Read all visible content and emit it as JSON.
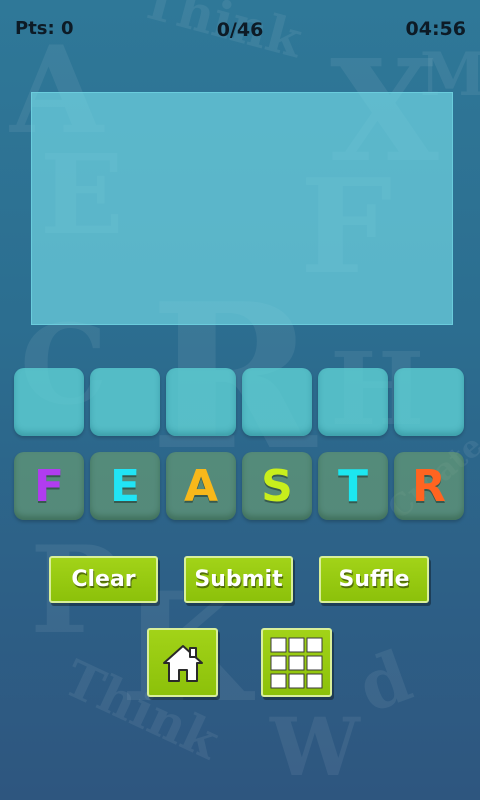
{
  "status": {
    "points_label": "Pts: 0",
    "progress": "0/46",
    "timer": "04:56"
  },
  "answer_display": {
    "current_word": ""
  },
  "answer_slots": 6,
  "letters": [
    {
      "char": "F",
      "color": "#b13cf0"
    },
    {
      "char": "E",
      "color": "#21e4f5"
    },
    {
      "char": "A",
      "color": "#f7b81a"
    },
    {
      "char": "S",
      "color": "#c8ee1c"
    },
    {
      "char": "T",
      "color": "#1ce7f0"
    },
    {
      "char": "R",
      "color": "#ff6420"
    }
  ],
  "buttons": {
    "clear": "Clear",
    "submit": "Submit",
    "shuffle": "Suffle"
  },
  "icons": {
    "home": "home-icon",
    "levels": "grid-icon"
  },
  "colors": {
    "button_green": "#97ca10",
    "panel_cyan": "#6fd8e4",
    "background": "#2d6a8e"
  }
}
